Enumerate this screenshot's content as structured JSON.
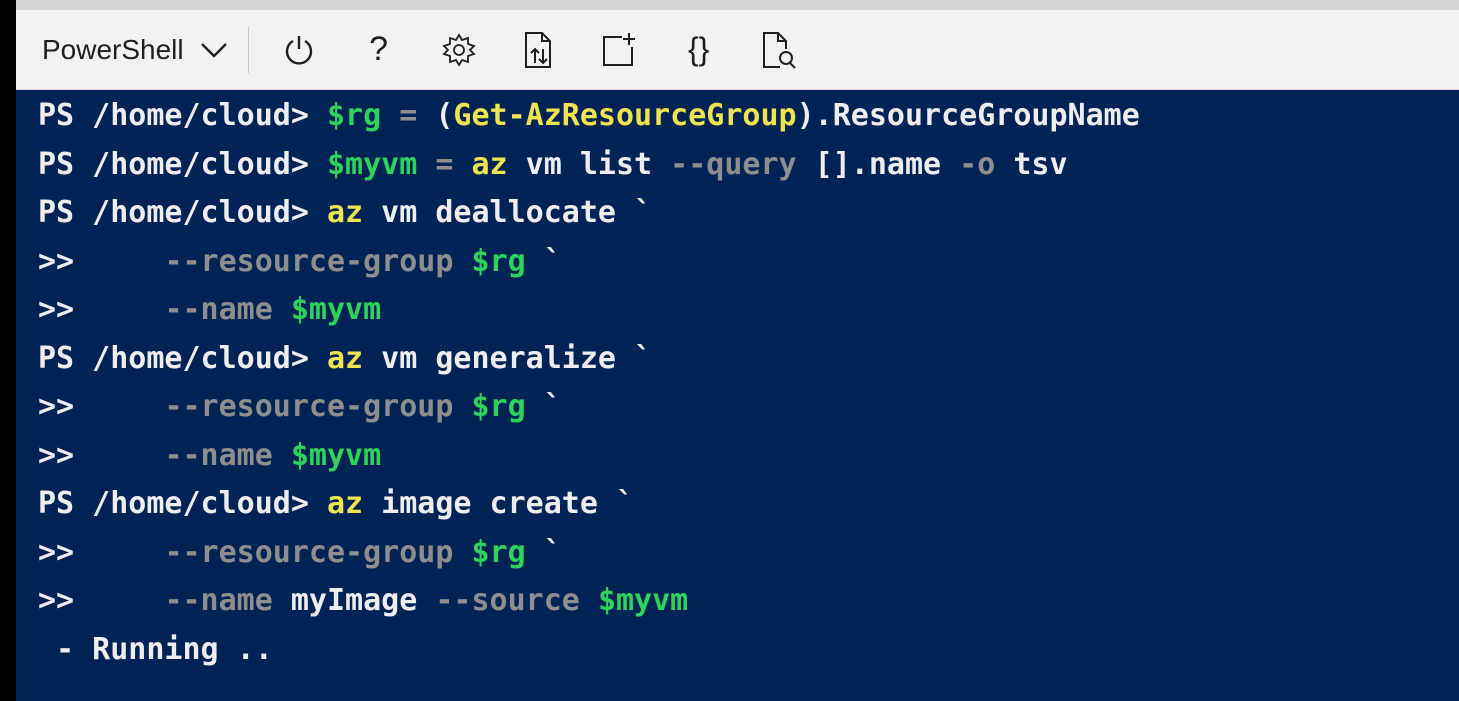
{
  "toolbar": {
    "shell_selector": "PowerShell",
    "icons": [
      {
        "name": "power-icon",
        "glyph": "power"
      },
      {
        "name": "help-icon",
        "glyph": "?"
      },
      {
        "name": "settings-gear-icon",
        "glyph": "gear"
      },
      {
        "name": "upload-download-file-icon",
        "glyph": "updown"
      },
      {
        "name": "new-session-icon",
        "glyph": "new"
      },
      {
        "name": "editor-braces-icon",
        "glyph": "{}"
      },
      {
        "name": "web-preview-icon",
        "glyph": "preview"
      }
    ]
  },
  "colors": {
    "terminal_bg": "#012456",
    "toolbar_bg": "#f2f2f2",
    "command": "#f0e350",
    "variable": "#2fd35c",
    "operator": "#8e8e8e",
    "text": "#eeedf0"
  },
  "terminal": {
    "lines": [
      [
        {
          "t": "PS /home/cloud> ",
          "c": "prompt"
        },
        {
          "t": "$rg",
          "c": "var"
        },
        {
          "t": " = ",
          "c": "op"
        },
        {
          "t": "(",
          "c": "arg"
        },
        {
          "t": "Get-AzResourceGroup",
          "c": "cmd"
        },
        {
          "t": ").ResourceGroupName",
          "c": "arg"
        }
      ],
      [
        {
          "t": "PS /home/cloud> ",
          "c": "prompt"
        },
        {
          "t": "$myvm",
          "c": "var"
        },
        {
          "t": " = ",
          "c": "op"
        },
        {
          "t": "az",
          "c": "cmd"
        },
        {
          "t": " vm list ",
          "c": "arg"
        },
        {
          "t": "--query",
          "c": "param"
        },
        {
          "t": " [].name ",
          "c": "arg"
        },
        {
          "t": "-o",
          "c": "param"
        },
        {
          "t": " tsv",
          "c": "arg"
        }
      ],
      [
        {
          "t": "PS /home/cloud> ",
          "c": "prompt"
        },
        {
          "t": "az",
          "c": "cmd"
        },
        {
          "t": " vm deallocate ",
          "c": "arg"
        },
        {
          "t": "`",
          "c": "tick"
        }
      ],
      [
        {
          "t": ">>     ",
          "c": "cont"
        },
        {
          "t": "--resource-group",
          "c": "param"
        },
        {
          "t": " ",
          "c": "arg"
        },
        {
          "t": "$rg",
          "c": "var"
        },
        {
          "t": " ",
          "c": "arg"
        },
        {
          "t": "`",
          "c": "tick"
        }
      ],
      [
        {
          "t": ">>     ",
          "c": "cont"
        },
        {
          "t": "--name",
          "c": "param"
        },
        {
          "t": " ",
          "c": "arg"
        },
        {
          "t": "$myvm",
          "c": "var"
        }
      ],
      [
        {
          "t": "PS /home/cloud> ",
          "c": "prompt"
        },
        {
          "t": "az",
          "c": "cmd"
        },
        {
          "t": " vm generalize ",
          "c": "arg"
        },
        {
          "t": "`",
          "c": "tick"
        }
      ],
      [
        {
          "t": ">>     ",
          "c": "cont"
        },
        {
          "t": "--resource-group",
          "c": "param"
        },
        {
          "t": " ",
          "c": "arg"
        },
        {
          "t": "$rg",
          "c": "var"
        },
        {
          "t": " ",
          "c": "arg"
        },
        {
          "t": "`",
          "c": "tick"
        }
      ],
      [
        {
          "t": ">>     ",
          "c": "cont"
        },
        {
          "t": "--name",
          "c": "param"
        },
        {
          "t": " ",
          "c": "arg"
        },
        {
          "t": "$myvm",
          "c": "var"
        }
      ],
      [
        {
          "t": "PS /home/cloud> ",
          "c": "prompt"
        },
        {
          "t": "az",
          "c": "cmd"
        },
        {
          "t": " image create ",
          "c": "arg"
        },
        {
          "t": "`",
          "c": "tick"
        }
      ],
      [
        {
          "t": ">>     ",
          "c": "cont"
        },
        {
          "t": "--resource-group",
          "c": "param"
        },
        {
          "t": " ",
          "c": "arg"
        },
        {
          "t": "$rg",
          "c": "var"
        },
        {
          "t": " ",
          "c": "arg"
        },
        {
          "t": "`",
          "c": "tick"
        }
      ],
      [
        {
          "t": ">>     ",
          "c": "cont"
        },
        {
          "t": "--name",
          "c": "param"
        },
        {
          "t": " myImage ",
          "c": "arg"
        },
        {
          "t": "--source",
          "c": "param"
        },
        {
          "t": " ",
          "c": "arg"
        },
        {
          "t": "$myvm",
          "c": "var"
        }
      ],
      [
        {
          "t": " - Running ..",
          "c": "status"
        }
      ]
    ]
  }
}
